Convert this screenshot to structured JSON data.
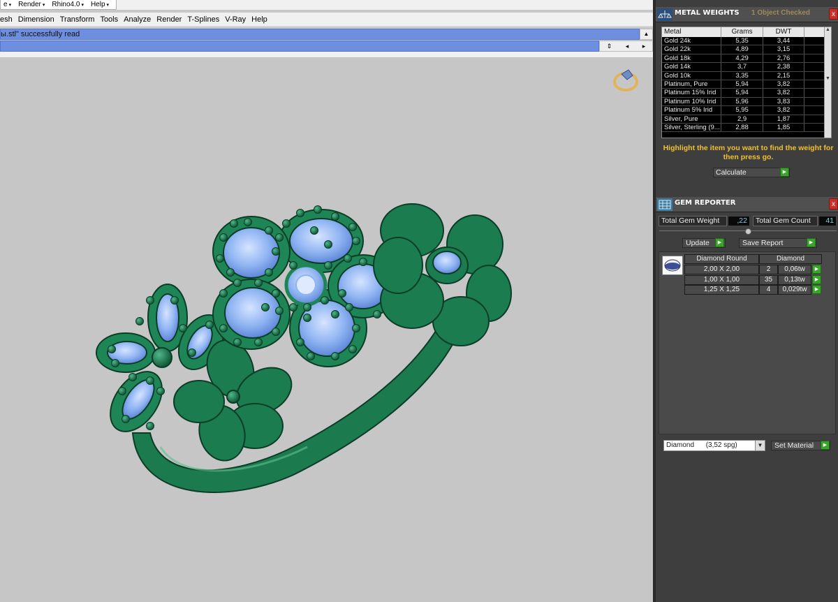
{
  "toolbar": {
    "top_menus": [
      "e",
      "Render",
      "Rhino4.0",
      "Help"
    ],
    "menu": [
      "esh",
      "Dimension",
      "Transform",
      "Tools",
      "Analyze",
      "Render",
      "T-Splines",
      "V-Ray",
      "Help"
    ]
  },
  "command": {
    "line1": "ы.stl\" successfully read",
    "line2": ""
  },
  "metal_weights": {
    "title": "METAL WEIGHTS",
    "subtitle": "1 Object Checked",
    "close": "x",
    "columns": [
      "Metal",
      "Grams",
      "DWT"
    ],
    "rows": [
      {
        "metal": "Gold 24k",
        "grams": "5,35",
        "dwt": "3,44"
      },
      {
        "metal": "Gold 22k",
        "grams": "4,89",
        "dwt": "3,15"
      },
      {
        "metal": "Gold 18k",
        "grams": "4,29",
        "dwt": "2,76"
      },
      {
        "metal": "Gold 14k",
        "grams": "3,7",
        "dwt": "2,38"
      },
      {
        "metal": "Gold 10k",
        "grams": "3,35",
        "dwt": "2,15"
      },
      {
        "metal": "Platinum, Pure",
        "grams": "5,94",
        "dwt": "3,82"
      },
      {
        "metal": "Platinum 15% Irid",
        "grams": "5,94",
        "dwt": "3,82"
      },
      {
        "metal": "Platinum 10% Irid",
        "grams": "5,96",
        "dwt": "3,83"
      },
      {
        "metal": "Platinum 5% Irid",
        "grams": "5,95",
        "dwt": "3,82"
      },
      {
        "metal": "Silver, Pure",
        "grams": "2,9",
        "dwt": "1,87"
      },
      {
        "metal": "Silver, Sterling (9...",
        "grams": "2,88",
        "dwt": "1,85"
      }
    ],
    "hint": "Highlight the item you want to find the weight for then press go.",
    "calc_label": "Calculate"
  },
  "gem_reporter": {
    "title": "GEM REPORTER",
    "close": "x",
    "total_weight_label": "Total Gem Weight",
    "total_weight_value": ",22",
    "total_count_label": "Total Gem Count",
    "total_count_value": "41",
    "update_label": "Update",
    "save_label": "Save Report",
    "gem_header_type": "Diamond Round",
    "gem_header_material": "Diamond",
    "gems": [
      {
        "size": "2,00 X 2,00",
        "count": "2",
        "weight": "0,06tw"
      },
      {
        "size": "1,00 X 1,00",
        "count": "35",
        "weight": "0,13tw"
      },
      {
        "size": "1,25 X 1,25",
        "count": "4",
        "weight": "0,029tw"
      }
    ],
    "material_select": "Diamond      (3,52 spg)",
    "set_material_label": "Set Material"
  },
  "colors": {
    "command_bar": "#6e8fe0",
    "ring_green": "#1b7a4e",
    "gem_blue": "#8fb4f2",
    "panel_bg": "#3e3e3e",
    "hint_yellow": "#f0c030",
    "go_green": "#3ba42a"
  }
}
